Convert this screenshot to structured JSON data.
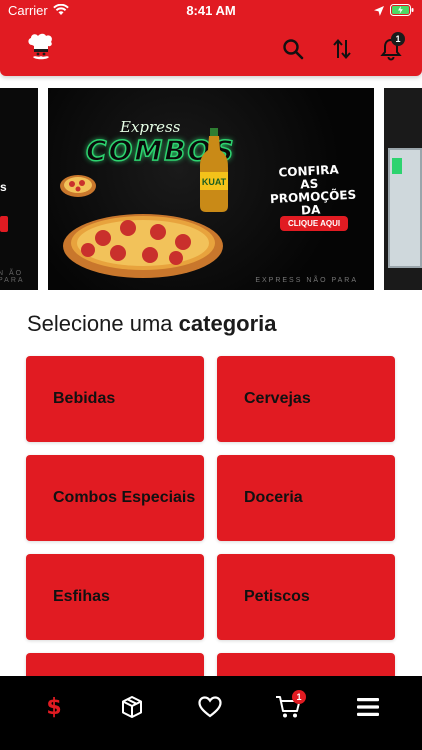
{
  "status_bar": {
    "carrier": "Carrier",
    "time": "8:41 AM"
  },
  "header": {
    "logo_icon": "chef-icon",
    "icons": [
      "search-icon",
      "sort-icon",
      "bell-icon"
    ],
    "notification_count": "1"
  },
  "banner": {
    "express": "Express",
    "combos": "COMBOS",
    "promo_text": "CONFIRA AS PROMOÇÕES DA SEMANA",
    "promo_button": "CLIQUE AQUI",
    "tagline": "EXPRESS NÃO PARA",
    "tagline_left": "N ÃO PARA",
    "bottle_label": "KUAT"
  },
  "section": {
    "title_prefix": "Selecione uma",
    "title_bold": "categoria"
  },
  "categories": [
    {
      "label": "Bebidas"
    },
    {
      "label": "Cervejas"
    },
    {
      "label": "Combos Especiais"
    },
    {
      "label": "Doceria"
    },
    {
      "label": "Esfihas"
    },
    {
      "label": "Petiscos"
    },
    {
      "label": ""
    },
    {
      "label": ""
    }
  ],
  "tabbar": {
    "icons": [
      "dollar-icon",
      "box-icon",
      "heart-icon",
      "cart-icon",
      "menu-icon"
    ],
    "dollar_label": "$",
    "cart_count": "1"
  },
  "colors": {
    "brand_red": "#e11b22",
    "tabbar_bg": "#000000",
    "neon_green": "#2dd36f"
  }
}
